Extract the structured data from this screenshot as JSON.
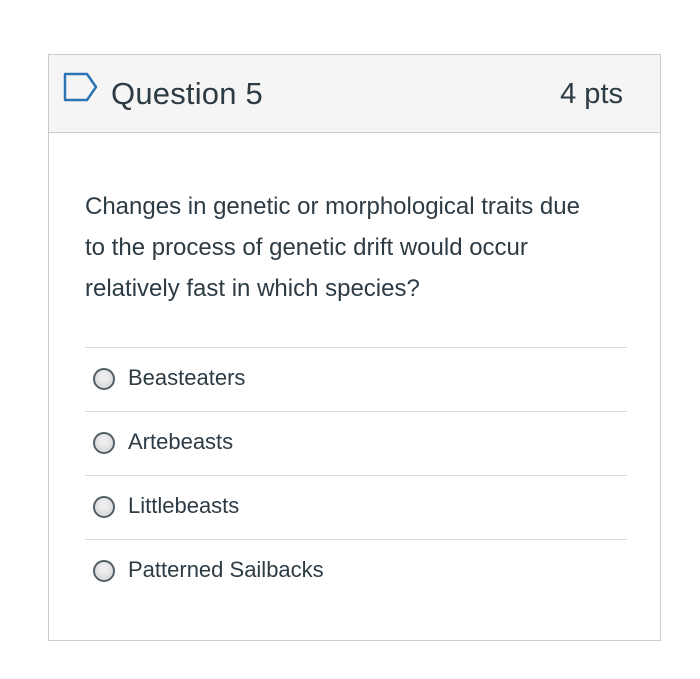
{
  "question": {
    "title": "Question 5",
    "points": "4 pts",
    "flag_icon": "flag-outline-icon",
    "text": "Changes in genetic or morphological traits due to the process of genetic drift would occur relatively fast in which species?",
    "answers": [
      {
        "label": "Beasteaters",
        "selected": false
      },
      {
        "label": "Artebeasts",
        "selected": false
      },
      {
        "label": "Littlebeasts",
        "selected": false
      },
      {
        "label": "Patterned Sailbacks",
        "selected": false
      }
    ]
  },
  "colors": {
    "accent": "#2d74b5",
    "text": "#2d3b45",
    "header_bg": "#f5f5f5",
    "border": "#c7cdd1"
  }
}
